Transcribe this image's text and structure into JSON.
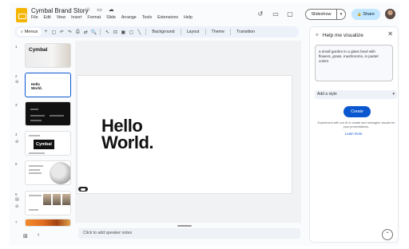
{
  "app": {
    "title": "Cymbal Brand Story",
    "title_icons": "☆ ▭ ☁",
    "menu": [
      "File",
      "Edit",
      "View",
      "Insert",
      "Format",
      "Slide",
      "Arrange",
      "Tools",
      "Extensions",
      "Help"
    ]
  },
  "header": {
    "history_icon": "↺",
    "comment_icon": "▭",
    "meet_icon": "▢",
    "slideshow_label": "Slideshow",
    "slideshow_dropdown": "▾",
    "share_label": "Share",
    "share_icon": "🔒"
  },
  "toolbar": {
    "menus_label": "Menus",
    "icons": [
      "+",
      "▢",
      "↶",
      "↷",
      "⎙",
      "⇄",
      "🔍"
    ],
    "background_label": "Background",
    "layout_label": "Layout",
    "theme_label": "Theme",
    "transition_label": "Transition"
  },
  "filmstrip": {
    "slides": [
      {
        "number": "1",
        "text": "Cymbal"
      },
      {
        "number": "2",
        "text": "Hello World."
      },
      {
        "number": "3"
      },
      {
        "number": "4",
        "text": "Cymbal"
      },
      {
        "number": "5"
      },
      {
        "number": "6"
      },
      {
        "number": "7"
      }
    ]
  },
  "canvas": {
    "slide_text_line1": "Hello",
    "slide_text_line2": "World.",
    "speaker_notes_placeholder": "Click to add speaker notes"
  },
  "panel": {
    "title": "Help me visualize",
    "close_icon": "✕",
    "prompt_text": "a small garden in a glass bowl with flowers, grass, mushrooms, in pastel colors",
    "style_label": "Add a style",
    "create_label": "Create",
    "info_text": "Experiment with our AI to create and reimagine visuals for your presentations.",
    "learn_more": "Learn more"
  },
  "colors": {
    "accent": "#0b57d0",
    "share_bg": "#c2e7ff",
    "logo": "#f4b400"
  }
}
